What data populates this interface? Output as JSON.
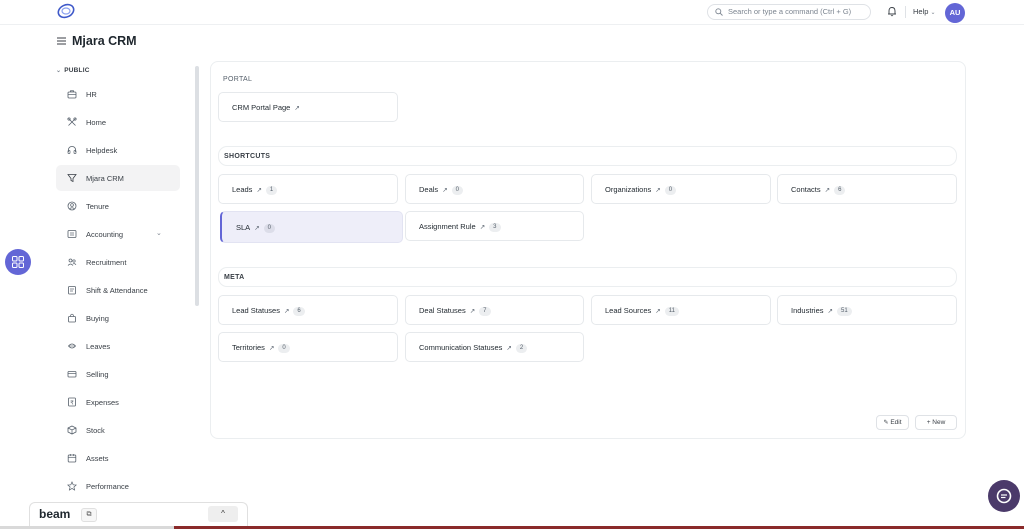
{
  "navbar": {
    "search_placeholder": "Search or type a command (Ctrl + G)",
    "help_label": "Help",
    "avatar_initials": "AU"
  },
  "page": {
    "title": "Mjara CRM"
  },
  "sidebar": {
    "section_label": "PUBLIC",
    "items": [
      {
        "label": "HR",
        "icon": "briefcase-icon"
      },
      {
        "label": "Home",
        "icon": "tools-icon"
      },
      {
        "label": "Helpdesk",
        "icon": "headset-icon"
      },
      {
        "label": "Mjara CRM",
        "icon": "filter-icon",
        "active": true
      },
      {
        "label": "Tenure",
        "icon": "user-circle-icon"
      },
      {
        "label": "Accounting",
        "icon": "ledger-icon",
        "expandable": true
      },
      {
        "label": "Recruitment",
        "icon": "users-icon"
      },
      {
        "label": "Shift & Attendance",
        "icon": "clipboard-icon"
      },
      {
        "label": "Buying",
        "icon": "shopping-bag-icon"
      },
      {
        "label": "Leaves",
        "icon": "leaf-icon"
      },
      {
        "label": "Selling",
        "icon": "card-icon"
      },
      {
        "label": "Expenses",
        "icon": "receipt-icon"
      },
      {
        "label": "Stock",
        "icon": "box-icon"
      },
      {
        "label": "Assets",
        "icon": "calendar-icon"
      },
      {
        "label": "Performance",
        "icon": "star-icon"
      }
    ]
  },
  "portal": {
    "heading": "PORTAL",
    "links": [
      {
        "label": "CRM Portal Page"
      }
    ]
  },
  "shortcuts": {
    "heading": "SHORTCUTS",
    "items": [
      {
        "label": "Leads",
        "count": "1"
      },
      {
        "label": "Deals",
        "count": "0"
      },
      {
        "label": "Organizations",
        "count": "0"
      },
      {
        "label": "Contacts",
        "count": "6"
      },
      {
        "label": "SLA",
        "count": "0",
        "active": true
      },
      {
        "label": "Assignment Rule",
        "count": "3"
      }
    ]
  },
  "meta": {
    "heading": "META",
    "items": [
      {
        "label": "Lead Statuses",
        "count": "6"
      },
      {
        "label": "Deal Statuses",
        "count": "7"
      },
      {
        "label": "Lead Sources",
        "count": "11"
      },
      {
        "label": "Industries",
        "count": "51"
      },
      {
        "label": "Territories",
        "count": "0"
      },
      {
        "label": "Communication Statuses",
        "count": "2"
      }
    ]
  },
  "actions": {
    "edit_label": "Edit",
    "new_label": "+ New"
  },
  "beam": {
    "name": "beam",
    "toggle_glyph": "^"
  },
  "colors": {
    "accent": "#6366d6",
    "active_bg": "#eeeef9",
    "fab": "#4b3a6a"
  }
}
